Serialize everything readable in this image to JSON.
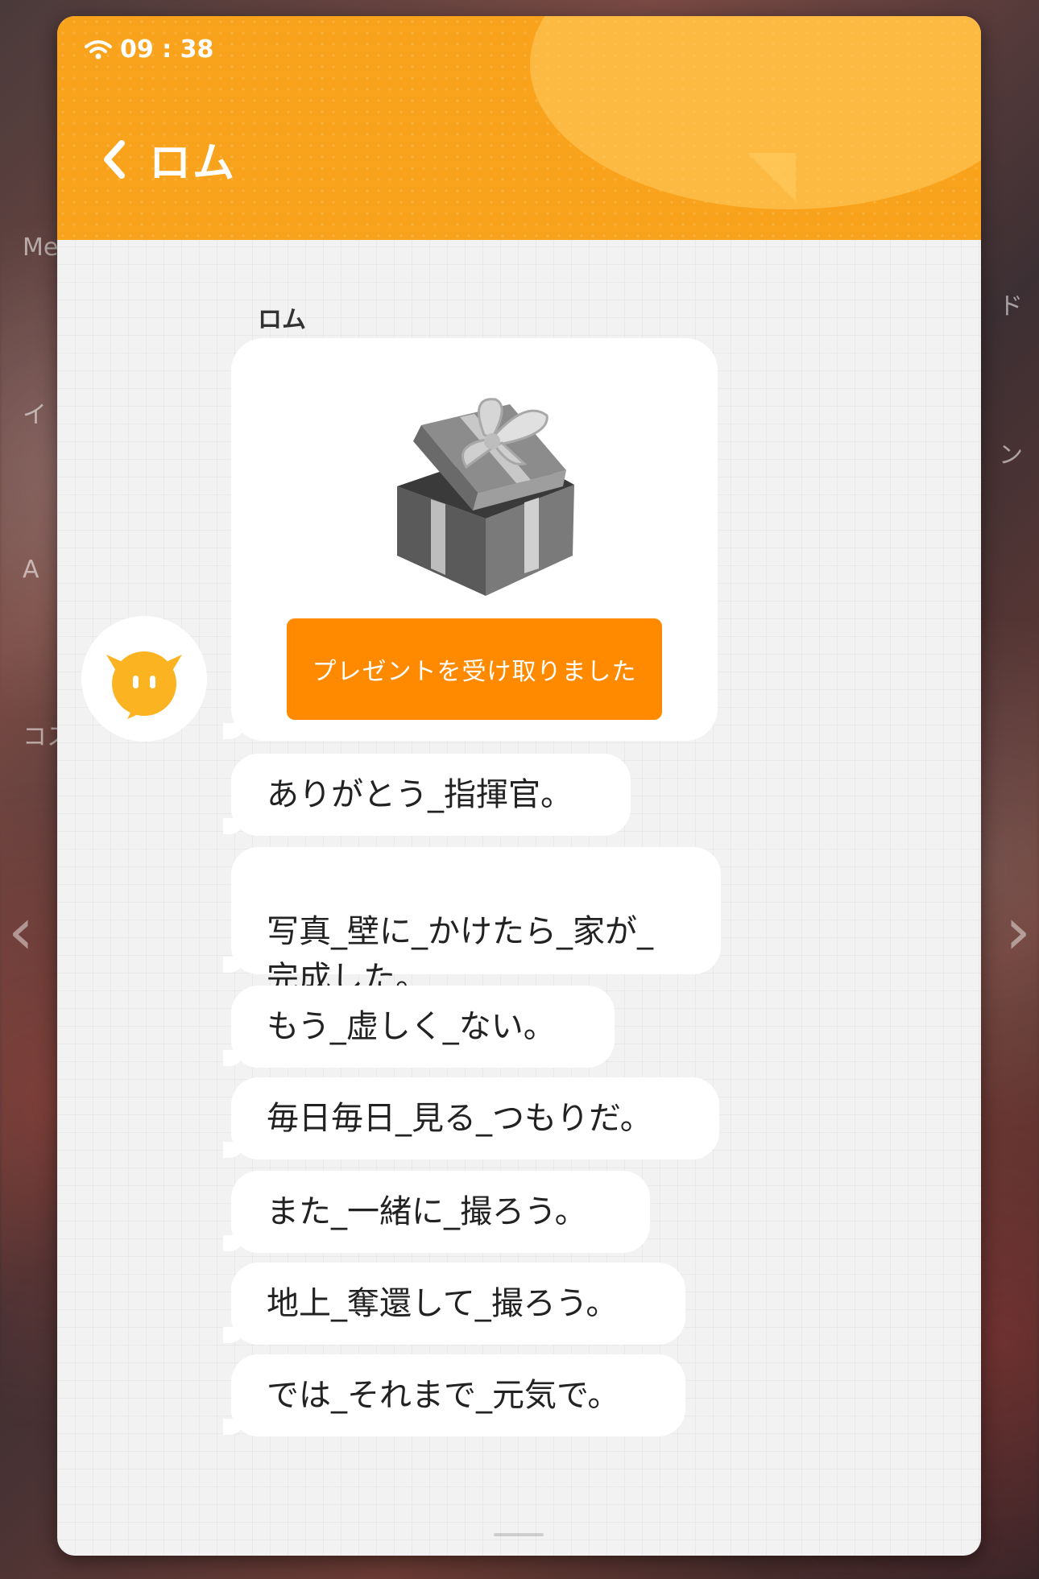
{
  "status_bar": {
    "time": "09 : 38"
  },
  "header": {
    "title": "ロム"
  },
  "chat": {
    "sender_name": "ロム",
    "gift": {
      "button_label": "プレゼントを受け取りました"
    },
    "messages": [
      "ありがとう_指揮官。",
      "写真_壁に_かけたら_家が_\n完成した。",
      "もう_虚しく_ない。",
      "毎日毎日_見る_つもりだ。",
      "また_一緒に_撮ろう。",
      "地上_奪還して_撮ろう。",
      "では_それまで_元気で。"
    ]
  },
  "background": {
    "left_labels": [
      "Me",
      "イ",
      "A",
      "コス"
    ],
    "right_labels": [
      "ド",
      "ン"
    ]
  },
  "colors": {
    "header": "#f9a31c",
    "gift_button": "#ff8a00",
    "avatar_face": "#fbb321"
  }
}
